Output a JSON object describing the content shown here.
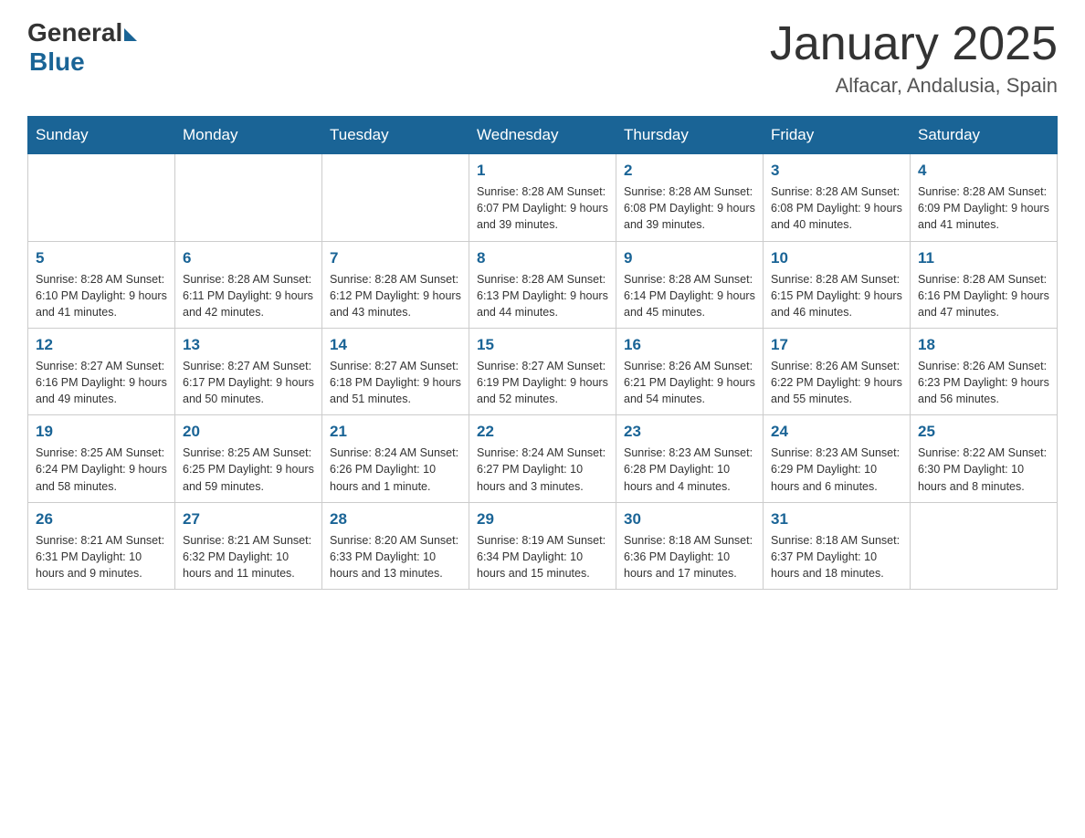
{
  "header": {
    "logo": {
      "general": "General",
      "blue": "Blue"
    },
    "title": "January 2025",
    "location": "Alfacar, Andalusia, Spain"
  },
  "days_of_week": [
    "Sunday",
    "Monday",
    "Tuesday",
    "Wednesday",
    "Thursday",
    "Friday",
    "Saturday"
  ],
  "weeks": [
    [
      {
        "day": "",
        "info": ""
      },
      {
        "day": "",
        "info": ""
      },
      {
        "day": "",
        "info": ""
      },
      {
        "day": "1",
        "info": "Sunrise: 8:28 AM\nSunset: 6:07 PM\nDaylight: 9 hours\nand 39 minutes."
      },
      {
        "day": "2",
        "info": "Sunrise: 8:28 AM\nSunset: 6:08 PM\nDaylight: 9 hours\nand 39 minutes."
      },
      {
        "day": "3",
        "info": "Sunrise: 8:28 AM\nSunset: 6:08 PM\nDaylight: 9 hours\nand 40 minutes."
      },
      {
        "day": "4",
        "info": "Sunrise: 8:28 AM\nSunset: 6:09 PM\nDaylight: 9 hours\nand 41 minutes."
      }
    ],
    [
      {
        "day": "5",
        "info": "Sunrise: 8:28 AM\nSunset: 6:10 PM\nDaylight: 9 hours\nand 41 minutes."
      },
      {
        "day": "6",
        "info": "Sunrise: 8:28 AM\nSunset: 6:11 PM\nDaylight: 9 hours\nand 42 minutes."
      },
      {
        "day": "7",
        "info": "Sunrise: 8:28 AM\nSunset: 6:12 PM\nDaylight: 9 hours\nand 43 minutes."
      },
      {
        "day": "8",
        "info": "Sunrise: 8:28 AM\nSunset: 6:13 PM\nDaylight: 9 hours\nand 44 minutes."
      },
      {
        "day": "9",
        "info": "Sunrise: 8:28 AM\nSunset: 6:14 PM\nDaylight: 9 hours\nand 45 minutes."
      },
      {
        "day": "10",
        "info": "Sunrise: 8:28 AM\nSunset: 6:15 PM\nDaylight: 9 hours\nand 46 minutes."
      },
      {
        "day": "11",
        "info": "Sunrise: 8:28 AM\nSunset: 6:16 PM\nDaylight: 9 hours\nand 47 minutes."
      }
    ],
    [
      {
        "day": "12",
        "info": "Sunrise: 8:27 AM\nSunset: 6:16 PM\nDaylight: 9 hours\nand 49 minutes."
      },
      {
        "day": "13",
        "info": "Sunrise: 8:27 AM\nSunset: 6:17 PM\nDaylight: 9 hours\nand 50 minutes."
      },
      {
        "day": "14",
        "info": "Sunrise: 8:27 AM\nSunset: 6:18 PM\nDaylight: 9 hours\nand 51 minutes."
      },
      {
        "day": "15",
        "info": "Sunrise: 8:27 AM\nSunset: 6:19 PM\nDaylight: 9 hours\nand 52 minutes."
      },
      {
        "day": "16",
        "info": "Sunrise: 8:26 AM\nSunset: 6:21 PM\nDaylight: 9 hours\nand 54 minutes."
      },
      {
        "day": "17",
        "info": "Sunrise: 8:26 AM\nSunset: 6:22 PM\nDaylight: 9 hours\nand 55 minutes."
      },
      {
        "day": "18",
        "info": "Sunrise: 8:26 AM\nSunset: 6:23 PM\nDaylight: 9 hours\nand 56 minutes."
      }
    ],
    [
      {
        "day": "19",
        "info": "Sunrise: 8:25 AM\nSunset: 6:24 PM\nDaylight: 9 hours\nand 58 minutes."
      },
      {
        "day": "20",
        "info": "Sunrise: 8:25 AM\nSunset: 6:25 PM\nDaylight: 9 hours\nand 59 minutes."
      },
      {
        "day": "21",
        "info": "Sunrise: 8:24 AM\nSunset: 6:26 PM\nDaylight: 10 hours\nand 1 minute."
      },
      {
        "day": "22",
        "info": "Sunrise: 8:24 AM\nSunset: 6:27 PM\nDaylight: 10 hours\nand 3 minutes."
      },
      {
        "day": "23",
        "info": "Sunrise: 8:23 AM\nSunset: 6:28 PM\nDaylight: 10 hours\nand 4 minutes."
      },
      {
        "day": "24",
        "info": "Sunrise: 8:23 AM\nSunset: 6:29 PM\nDaylight: 10 hours\nand 6 minutes."
      },
      {
        "day": "25",
        "info": "Sunrise: 8:22 AM\nSunset: 6:30 PM\nDaylight: 10 hours\nand 8 minutes."
      }
    ],
    [
      {
        "day": "26",
        "info": "Sunrise: 8:21 AM\nSunset: 6:31 PM\nDaylight: 10 hours\nand 9 minutes."
      },
      {
        "day": "27",
        "info": "Sunrise: 8:21 AM\nSunset: 6:32 PM\nDaylight: 10 hours\nand 11 minutes."
      },
      {
        "day": "28",
        "info": "Sunrise: 8:20 AM\nSunset: 6:33 PM\nDaylight: 10 hours\nand 13 minutes."
      },
      {
        "day": "29",
        "info": "Sunrise: 8:19 AM\nSunset: 6:34 PM\nDaylight: 10 hours\nand 15 minutes."
      },
      {
        "day": "30",
        "info": "Sunrise: 8:18 AM\nSunset: 6:36 PM\nDaylight: 10 hours\nand 17 minutes."
      },
      {
        "day": "31",
        "info": "Sunrise: 8:18 AM\nSunset: 6:37 PM\nDaylight: 10 hours\nand 18 minutes."
      },
      {
        "day": "",
        "info": ""
      }
    ]
  ]
}
